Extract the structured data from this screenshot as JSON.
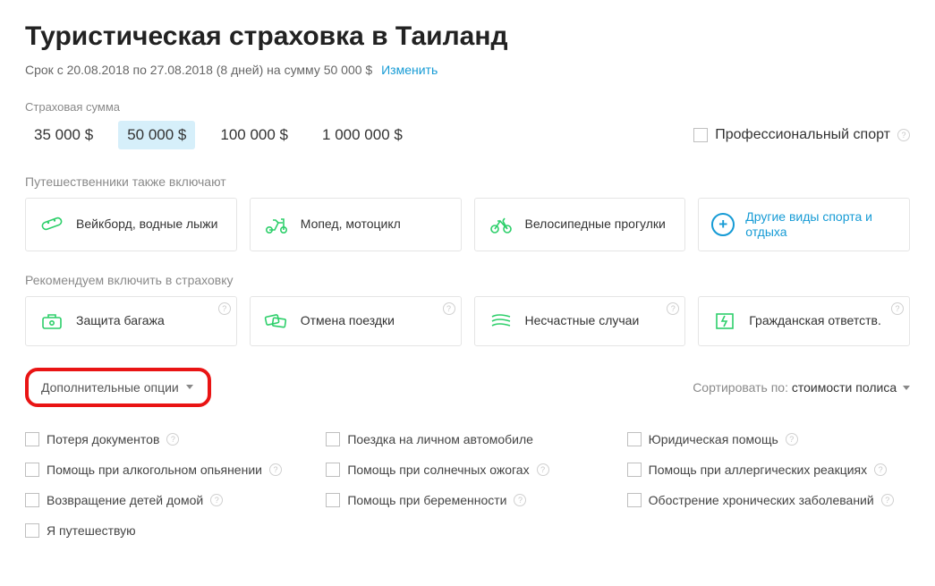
{
  "title": "Туристическая страховка в Таиланд",
  "subtitle": {
    "text": "Срок с 20.08.2018 по 27.08.2018 (8 дней) на сумму 50 000 $",
    "edit": "Изменить"
  },
  "sum_label": "Страховая сумма",
  "sums": [
    "35 000 $",
    "50 000 $",
    "100 000 $",
    "1 000 000 $"
  ],
  "sum_selected_index": 1,
  "prof_sport": "Профессиональный спорт",
  "also_include_label": "Путешественники также включают",
  "also_cards": [
    {
      "label": "Вейкборд, водные лыжи",
      "icon": "wakeboard"
    },
    {
      "label": "Мопед, мотоцикл",
      "icon": "moped"
    },
    {
      "label": "Велосипедные прогулки",
      "icon": "bicycle"
    },
    {
      "label": "Другие виды спорта и отдыха",
      "icon": "more"
    }
  ],
  "recommend_label": "Рекомендуем включить в страховку",
  "recommend_cards": [
    {
      "label": "Защита багажа",
      "icon": "luggage"
    },
    {
      "label": "Отмена поездки",
      "icon": "cancel-trip"
    },
    {
      "label": "Несчастные случаи",
      "icon": "accident"
    },
    {
      "label": "Гражданская ответств.",
      "icon": "liability"
    }
  ],
  "opts_btn": "Дополнительные опции",
  "sort_label": "Сортировать по:",
  "sort_value": "стоимости полиса",
  "checkboxes": [
    {
      "label": "Потеря документов",
      "help": true
    },
    {
      "label": "Поездка на личном автомобиле",
      "help": false
    },
    {
      "label": "Юридическая помощь",
      "help": true
    },
    {
      "label": "Помощь при алкогольном опьянении",
      "help": true
    },
    {
      "label": "Помощь при солнечных ожогах",
      "help": true
    },
    {
      "label": "Помощь при аллергических реакциях",
      "help": true
    },
    {
      "label": "Возвращение детей домой",
      "help": true
    },
    {
      "label": "Помощь при беременности",
      "help": true
    },
    {
      "label": "Обострение хронических заболеваний",
      "help": true
    },
    {
      "label": "Я путешествую",
      "help": false
    }
  ]
}
